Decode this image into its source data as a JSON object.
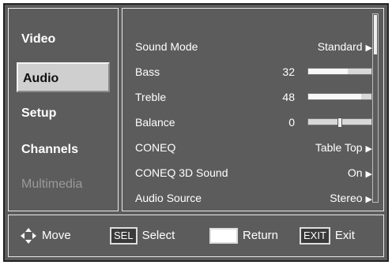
{
  "menu": {
    "categories": [
      {
        "label": "Video"
      },
      {
        "label": "Audio"
      },
      {
        "label": "Setup"
      },
      {
        "label": "Channels"
      },
      {
        "label": "Multimedia"
      }
    ]
  },
  "audio_settings": {
    "sound_mode": {
      "label": "Sound Mode",
      "value": "Standard"
    },
    "bass": {
      "label": "Bass",
      "value": "32",
      "level": 0.62
    },
    "treble": {
      "label": "Treble",
      "value": "48",
      "level": 0.84
    },
    "balance": {
      "label": "Balance",
      "value": "0",
      "level": 0.5
    },
    "coneq": {
      "label": "CONEQ",
      "value": "Table Top"
    },
    "coneq_3d": {
      "label": "CONEQ 3D Sound",
      "value": "On"
    },
    "audio_source": {
      "label": "Audio Source",
      "value": "Stereo"
    }
  },
  "controls": {
    "move": "Move",
    "sel_key": "SEL",
    "select": "Select",
    "return": "Return",
    "exit_key": "EXIT",
    "exit": "Exit"
  },
  "icons": {
    "arrow": "right-triangle-icon",
    "move": "four-way-arrow-icon"
  }
}
